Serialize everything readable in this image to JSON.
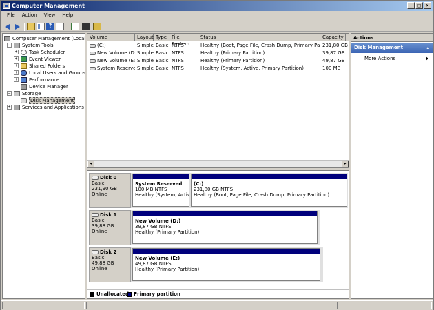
{
  "window": {
    "title": "Computer Management"
  },
  "menu": [
    "File",
    "Action",
    "View",
    "Help"
  ],
  "tree": {
    "root": "Computer Management (Local)",
    "system_tools": "System Tools",
    "task_scheduler": "Task Scheduler",
    "event_viewer": "Event Viewer",
    "shared_folders": "Shared Folders",
    "local_users": "Local Users and Groups",
    "performance": "Performance",
    "device_manager": "Device Manager",
    "storage": "Storage",
    "disk_management": "Disk Management",
    "services": "Services and Applications"
  },
  "volume_list": {
    "columns": [
      "Volume",
      "Layout",
      "Type",
      "File System",
      "Status",
      "Capacity"
    ],
    "rows": [
      [
        "(C:)",
        "Simple",
        "Basic",
        "NTFS",
        "Healthy (Boot, Page File, Crash Dump, Primary Partition)",
        "231,80 GB"
      ],
      [
        "New Volume (D:)",
        "Simple",
        "Basic",
        "NTFS",
        "Healthy (Primary Partition)",
        "39,87 GB"
      ],
      [
        "New Volume (E:)",
        "Simple",
        "Basic",
        "NTFS",
        "Healthy (Primary Partition)",
        "49,87 GB"
      ],
      [
        "System Reserved",
        "Simple",
        "Basic",
        "NTFS",
        "Healthy (System, Active, Primary Partition)",
        "100 MB"
      ]
    ]
  },
  "disks": [
    {
      "name": "Disk 0",
      "type": "Basic",
      "size": "231,90 GB",
      "state": "Online",
      "partitions": [
        {
          "name": "System Reserved",
          "size": "100 MB NTFS",
          "status": "Healthy (System, Active,"
        },
        {
          "name": "(C:)",
          "size": "231,80 GB NTFS",
          "status": "Healthy (Boot, Page File, Crash Dump, Primary Partition)"
        }
      ]
    },
    {
      "name": "Disk 1",
      "type": "Basic",
      "size": "39,88 GB",
      "state": "Online",
      "partitions": [
        {
          "name": "New Volume  (D:)",
          "size": "39,87 GB NTFS",
          "status": "Healthy (Primary Partition)"
        }
      ]
    },
    {
      "name": "Disk 2",
      "type": "Basic",
      "size": "49,88 GB",
      "state": "Online",
      "partitions": [
        {
          "name": "New Volume  (E:)",
          "size": "49,87 GB NTFS",
          "status": "Healthy (Primary Partition)"
        }
      ]
    }
  ],
  "legend": {
    "unallocated": "Unallocated",
    "primary": "Primary partition",
    "unallocated_color": "#000000",
    "primary_color": "#00007c"
  },
  "actions": {
    "header": "Actions",
    "section": "Disk Management",
    "more": "More Actions"
  }
}
